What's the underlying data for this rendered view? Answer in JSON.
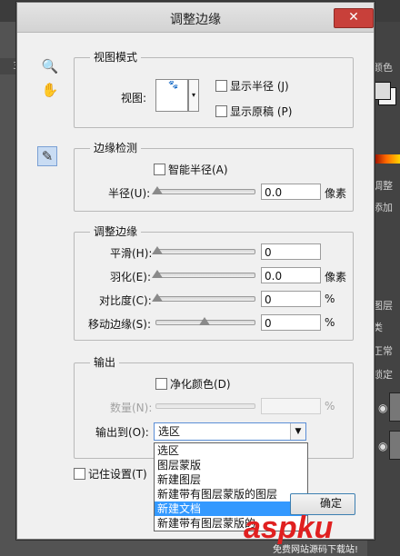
{
  "dialog": {
    "title": "调整边缘",
    "close_glyph": "✕"
  },
  "tools": {
    "zoom_glyph": "🔍",
    "hand_glyph": "✋",
    "brush_glyph": "✎"
  },
  "view_mode": {
    "legend": "视图模式",
    "view_label": "视图:",
    "show_radius": "显示半径 (J)",
    "show_original": "显示原稿 (P)"
  },
  "edge_detection": {
    "legend": "边缘检测",
    "smart_radius": "智能半径(A)",
    "radius_label": "半径(U):",
    "radius_value": "0.0",
    "radius_unit": "像素"
  },
  "adjust_edge": {
    "legend": "调整边缘",
    "smooth_label": "平滑(H):",
    "smooth_value": "0",
    "feather_label": "羽化(E):",
    "feather_value": "0.0",
    "feather_unit": "像素",
    "contrast_label": "对比度(C):",
    "contrast_value": "0",
    "contrast_unit": "%",
    "shift_label": "移动边缘(S):",
    "shift_value": "0",
    "shift_unit": "%",
    "shift_position": 0.5
  },
  "output": {
    "legend": "输出",
    "decontaminate": "净化颜色(D)",
    "amount_label": "数量(N):",
    "amount_unit": "%",
    "output_to_label": "输出到(O):",
    "output_to_value": "选区",
    "options": [
      "选区",
      "图层蒙版",
      "新建图层",
      "新建带有图层蒙版的图层",
      "新建文档",
      "新建带有图层蒙版的"
    ],
    "highlighted_option": "新建文档"
  },
  "remember_settings": "记住设置(T)",
  "ok_button": "确定",
  "watermark": {
    "text": "aspku",
    "sub": "免费网站源码下载站!"
  },
  "background": {
    "ruler_num": "3",
    "panel_color": "颜色",
    "panel_adjust": "调整",
    "panel_add": "添加",
    "panel_layers": "图层",
    "panel_kind": "类",
    "panel_normal": "正常",
    "panel_lock": "锁定"
  }
}
